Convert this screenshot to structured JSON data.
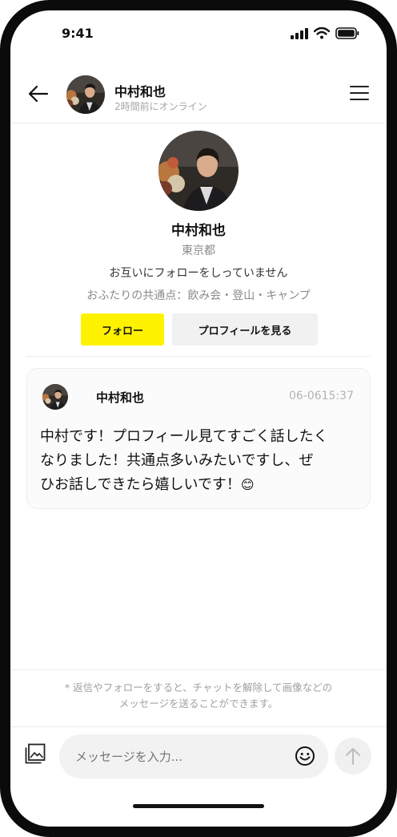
{
  "status_bar": {
    "time": "9:41"
  },
  "header": {
    "name": "中村和也",
    "status": "2時間前にオンライン"
  },
  "profile": {
    "name": "中村和也",
    "location": "東京都",
    "relation": "お互いにフォローをしっていません",
    "common_label": "おふたりの共通点：",
    "common_values": "飲み会・登山・キャンプ",
    "follow_label": "フォロー",
    "view_profile_label": "プロフィールを見る"
  },
  "message": {
    "sender": "中村和也",
    "time": "06-0615:37",
    "lines": [
      "中村です！プロフィール見てすごく話したく",
      "なりました！共通点多いみたいですし、ぜ",
      "ひお話しできたら嬉しいです！"
    ],
    "emoji": "😊"
  },
  "notice": {
    "line1": "* 返信やフォローをすると、チャットを解除して画像などの",
    "line2": "メッセージを送ることができます。"
  },
  "composer": {
    "placeholder": "メッセージを入力..."
  },
  "icons": {
    "back": "arrow-left-icon",
    "menu": "hamburger-menu-icon",
    "image": "image-icon",
    "emoji": "smiley-icon",
    "send": "arrow-up-icon"
  },
  "colors": {
    "accent_yellow": "#fff200",
    "frame": "#0b0b0b"
  }
}
